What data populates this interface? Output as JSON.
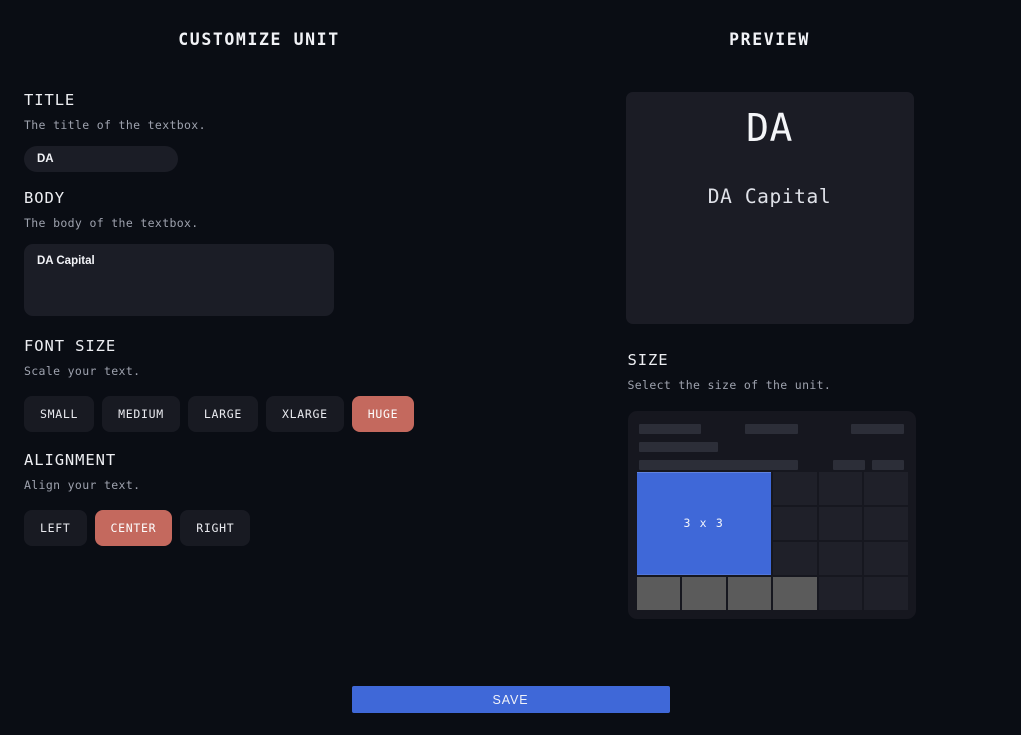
{
  "left_pane": {
    "heading": "CUSTOMIZE UNIT",
    "title_field": {
      "label": "TITLE",
      "hint": "The title of the textbox.",
      "value": "DA",
      "placeholder": ""
    },
    "body_field": {
      "label": "BODY",
      "hint": "The body of the textbox.",
      "value": "DA Capital",
      "placeholder": ""
    },
    "font_size": {
      "label": "FONT SIZE",
      "hint": "Scale your text.",
      "options": [
        "SMALL",
        "MEDIUM",
        "LARGE",
        "XLARGE",
        "HUGE"
      ],
      "selected": "HUGE"
    },
    "alignment": {
      "label": "ALIGNMENT",
      "hint": "Align your text.",
      "options": [
        "LEFT",
        "CENTER",
        "RIGHT"
      ],
      "selected": "CENTER"
    }
  },
  "right_pane": {
    "heading": "PREVIEW",
    "preview": {
      "title": "DA",
      "body": "DA Capital"
    },
    "size": {
      "label": "SIZE",
      "hint": "Select the size of the unit.",
      "selected_label": "3 x 3",
      "grid_columns": 6,
      "grid_rows": 4,
      "filled_cells": [
        [
          0,
          2
        ],
        [
          1,
          2
        ],
        [
          2,
          2
        ],
        [
          3,
          0
        ],
        [
          3,
          1
        ],
        [
          3,
          2
        ],
        [
          3,
          3
        ]
      ]
    }
  },
  "footer": {
    "save_label": "SAVE"
  },
  "colors": {
    "background": "#0a0d14",
    "surface": "#1b1d26",
    "panel": "#16171f",
    "accent_blue": "#3f68d8",
    "accent_salmon": "#c4695e",
    "cell_filled": "#5b5b5b",
    "cell_empty": "#1f2029",
    "text_primary": "#edeef2",
    "text_muted": "#9ea2ae"
  }
}
